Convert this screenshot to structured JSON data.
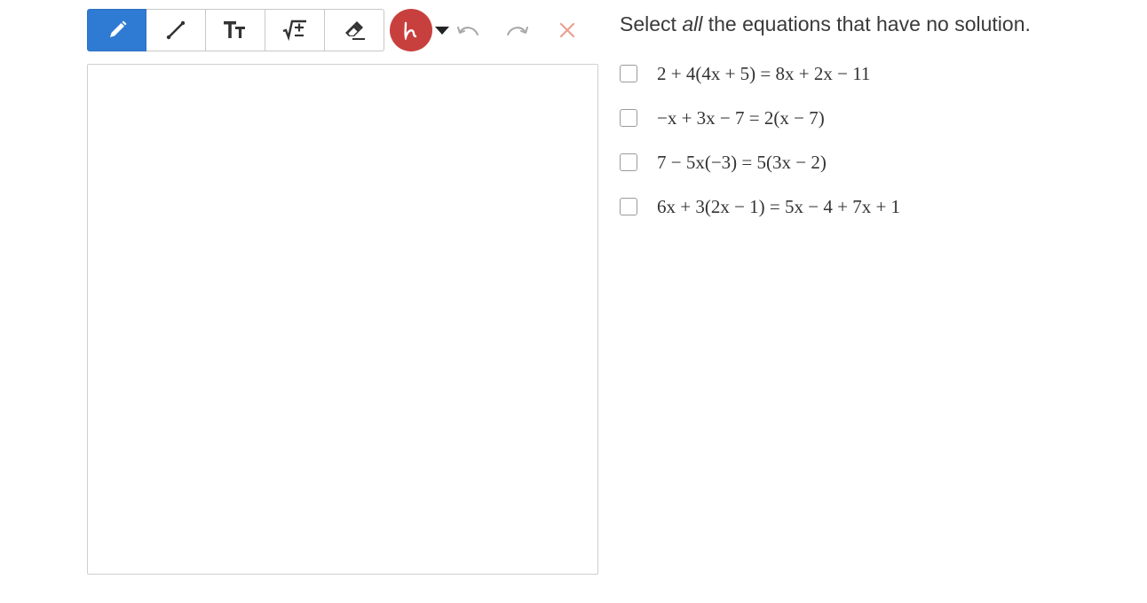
{
  "toolbar": {
    "tools": [
      {
        "name": "pencil",
        "icon": "pencil-icon",
        "active": true
      },
      {
        "name": "line",
        "icon": "line-icon",
        "active": false
      },
      {
        "name": "text",
        "icon": "text-size-icon",
        "label": "TT",
        "active": false
      },
      {
        "name": "math",
        "icon": "math-icon",
        "label": "√±",
        "active": false
      },
      {
        "name": "eraser",
        "icon": "eraser-icon",
        "active": false
      }
    ],
    "color": "#c8403e",
    "active_color_hex": "#2f7bd3"
  },
  "question": {
    "prefix": "Select ",
    "emphasis": "all",
    "suffix": " the equations that have no solution."
  },
  "choices": [
    {
      "equation": "2 + 4(4x + 5) = 8x + 2x − 11",
      "checked": false
    },
    {
      "equation": "−x + 3x − 7 = 2(x − 7)",
      "checked": false
    },
    {
      "equation": "7 − 5x(−3) = 5(3x − 2)",
      "checked": false
    },
    {
      "equation": "6x + 3(2x − 1) = 5x − 4 + 7x + 1",
      "checked": false
    }
  ]
}
